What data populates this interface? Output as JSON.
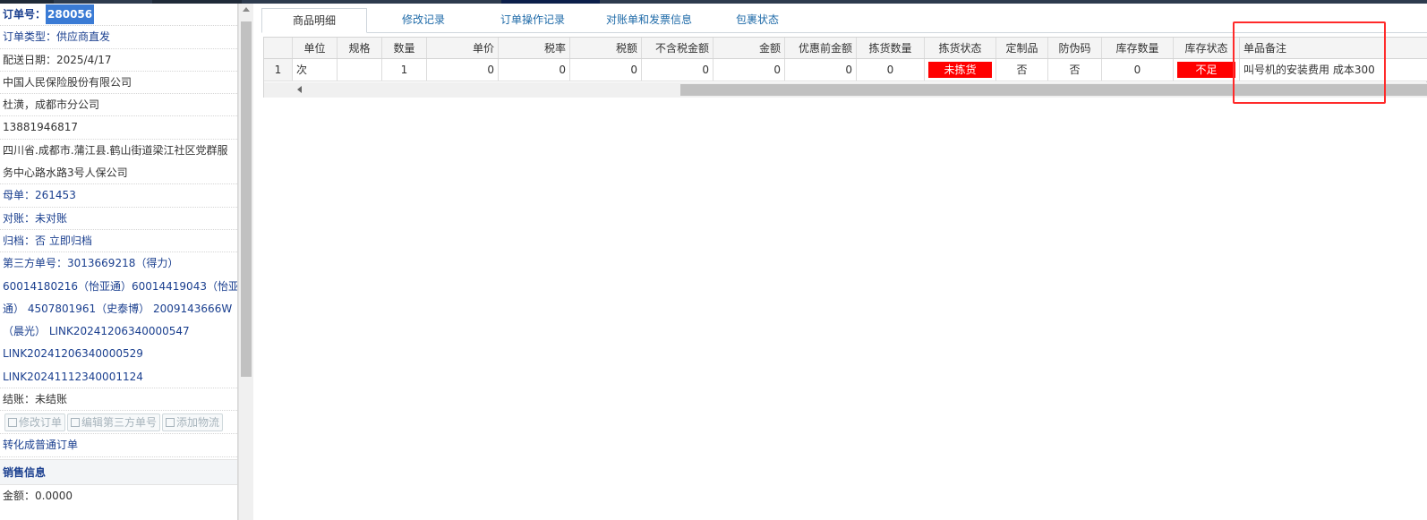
{
  "order": {
    "label": "订单号：",
    "number": "280056",
    "type": "订单类型：供应商直发",
    "delivery_date": "配送日期：2025/4/17",
    "company": "中国人民保险股份有限公司",
    "contact": "杜潢，成都市分公司",
    "phone": "13881946817",
    "address_line1": "四川省.成都市.蒲江县.鹤山街道梁江社区党群服",
    "address_line2": "务中心路水路3号人保公司",
    "parent_label": "母单：",
    "parent_value": "261453",
    "recon_label": "对账：",
    "recon_value": "未对账",
    "archive_label": "归档：",
    "archive_value": "否 立即归档",
    "third_party_lines": [
      "第三方单号：3013669218（得力）",
      "60014180216（怡亚通）60014419043（怡亚",
      "通） 4507801961（史泰博） 2009143666W",
      "（晨光） LINK20241206340000547",
      "LINK20241206340000529",
      "LINK20241112340001124"
    ],
    "settle_label": "结账：",
    "settle_value": "未结账",
    "buttons": {
      "edit": "修改订单",
      "edit_third": "编辑第三方单号",
      "add_logistics": "添加物流"
    },
    "convert_link": "转化成普通订单",
    "sales_section": "销售信息",
    "amount": "金额：0.0000"
  },
  "tabs": [
    "商品明细",
    "修改记录",
    "订单操作记录",
    "对账单和发票信息",
    "包裹状态"
  ],
  "table": {
    "headers": [
      "",
      "单位",
      "规格",
      "数量",
      "单价",
      "税率",
      "税额",
      "不含税金额",
      "金额",
      "优惠前金额",
      "拣货数量",
      "拣货状态",
      "定制品",
      "防伪码",
      "库存数量",
      "库存状态",
      "单品备注"
    ],
    "rows": [
      [
        "1",
        "次",
        "",
        "1",
        "0",
        "0",
        "0",
        "0",
        "0",
        "0",
        "0",
        "未拣货",
        "否",
        "否",
        "0",
        "不足",
        "叫号机的安装费用 成本300"
      ]
    ]
  },
  "colors": {
    "accent": "#1e6aa8",
    "label_blue": "#1a3f8f",
    "alert_red": "#ff0000",
    "highlight_border": "#ff2a2a"
  }
}
